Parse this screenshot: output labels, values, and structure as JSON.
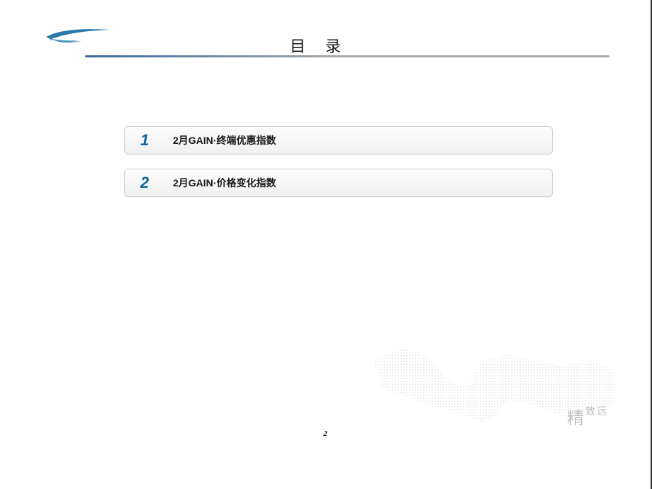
{
  "title": "目录",
  "toc": [
    {
      "number": "1",
      "label": "2月GAIN·终端优惠指数"
    },
    {
      "number": "2",
      "label": "2月GAIN·价格变化指数"
    }
  ],
  "pageNumber": "2",
  "watermark": {
    "main": "精",
    "suffix": "致远"
  }
}
